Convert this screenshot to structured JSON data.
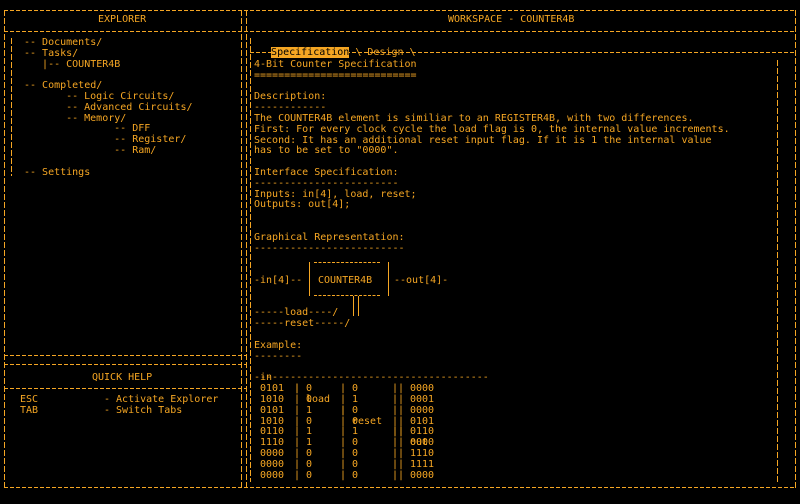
{
  "explorer": {
    "title": "EXPLORER",
    "tree": [
      "-- Documents/",
      "-- Tasks/",
      "   |-- COUNTER4B",
      "",
      "-- Completed/",
      "    -- Logic Circuits/",
      "    -- Advanced Circuits/",
      "    -- Memory/",
      "        -- DFF",
      "        -- Register/",
      "        -- Ram/",
      "",
      "-- Settings"
    ]
  },
  "quick_help": {
    "title": "QUICK HELP",
    "items": [
      {
        "key": "ESC",
        "desc": "- Activate Explorer"
      },
      {
        "key": "TAB",
        "desc": "- Switch Tabs"
      }
    ]
  },
  "workspace": {
    "title": "WORKSPACE - COUNTER4B",
    "tabs": {
      "active": "Specification",
      "separator": " \\ ",
      "inactive": "Design",
      "trail": " \\"
    },
    "doc": {
      "title": "4-Bit Counter Specification",
      "title_rule": "===========================",
      "desc_heading": "Description:",
      "desc_rule": "------------",
      "desc_lines": [
        "The COUNTER4B element is similiar to an REGISTER4B, with two differences.",
        "First: For every clock cycle the load flag is 0, the internal value increments.",
        "Second: It has an additional reset input flag. If it is 1 the internal value",
        "has to be set to \"0000\"."
      ],
      "iface_heading": "Interface Specification:",
      "iface_rule": "------------------------",
      "inputs": "Inputs: in[4], load, reset;",
      "outputs": "Outputs: out[4];",
      "graph_heading": "Graphical Representation:",
      "graph_rule": "-------------------------",
      "graph_lines": [
        "             ___________",
        "            |           |",
        "-in[4]--   |  COUNTER4B |  --out[4]-",
        "            |___________|",
        "                    |  |",
        "-----load----/  |",
        "-----reset-----/"
      ],
      "example_heading": "Example:",
      "example_rule": "--------",
      "example_cols": [
        "in",
        "load",
        "reset",
        "out"
      ],
      "example_rows": [
        [
          "0101",
          "0",
          "0",
          "0000"
        ],
        [
          "1010",
          "0",
          "1",
          "0001"
        ],
        [
          "0101",
          "1",
          "0",
          "0000"
        ],
        [
          "1010",
          "0",
          "0",
          "0101"
        ],
        [
          "0110",
          "1",
          "1",
          "0110"
        ],
        [
          "1110",
          "1",
          "0",
          "0000"
        ],
        [
          "0000",
          "0",
          "0",
          "1110"
        ],
        [
          "0000",
          "0",
          "0",
          "1111"
        ],
        [
          "0000",
          "0",
          "0",
          "0000"
        ]
      ]
    }
  },
  "colors": {
    "accent": "#f5a623",
    "background": "#000000"
  }
}
